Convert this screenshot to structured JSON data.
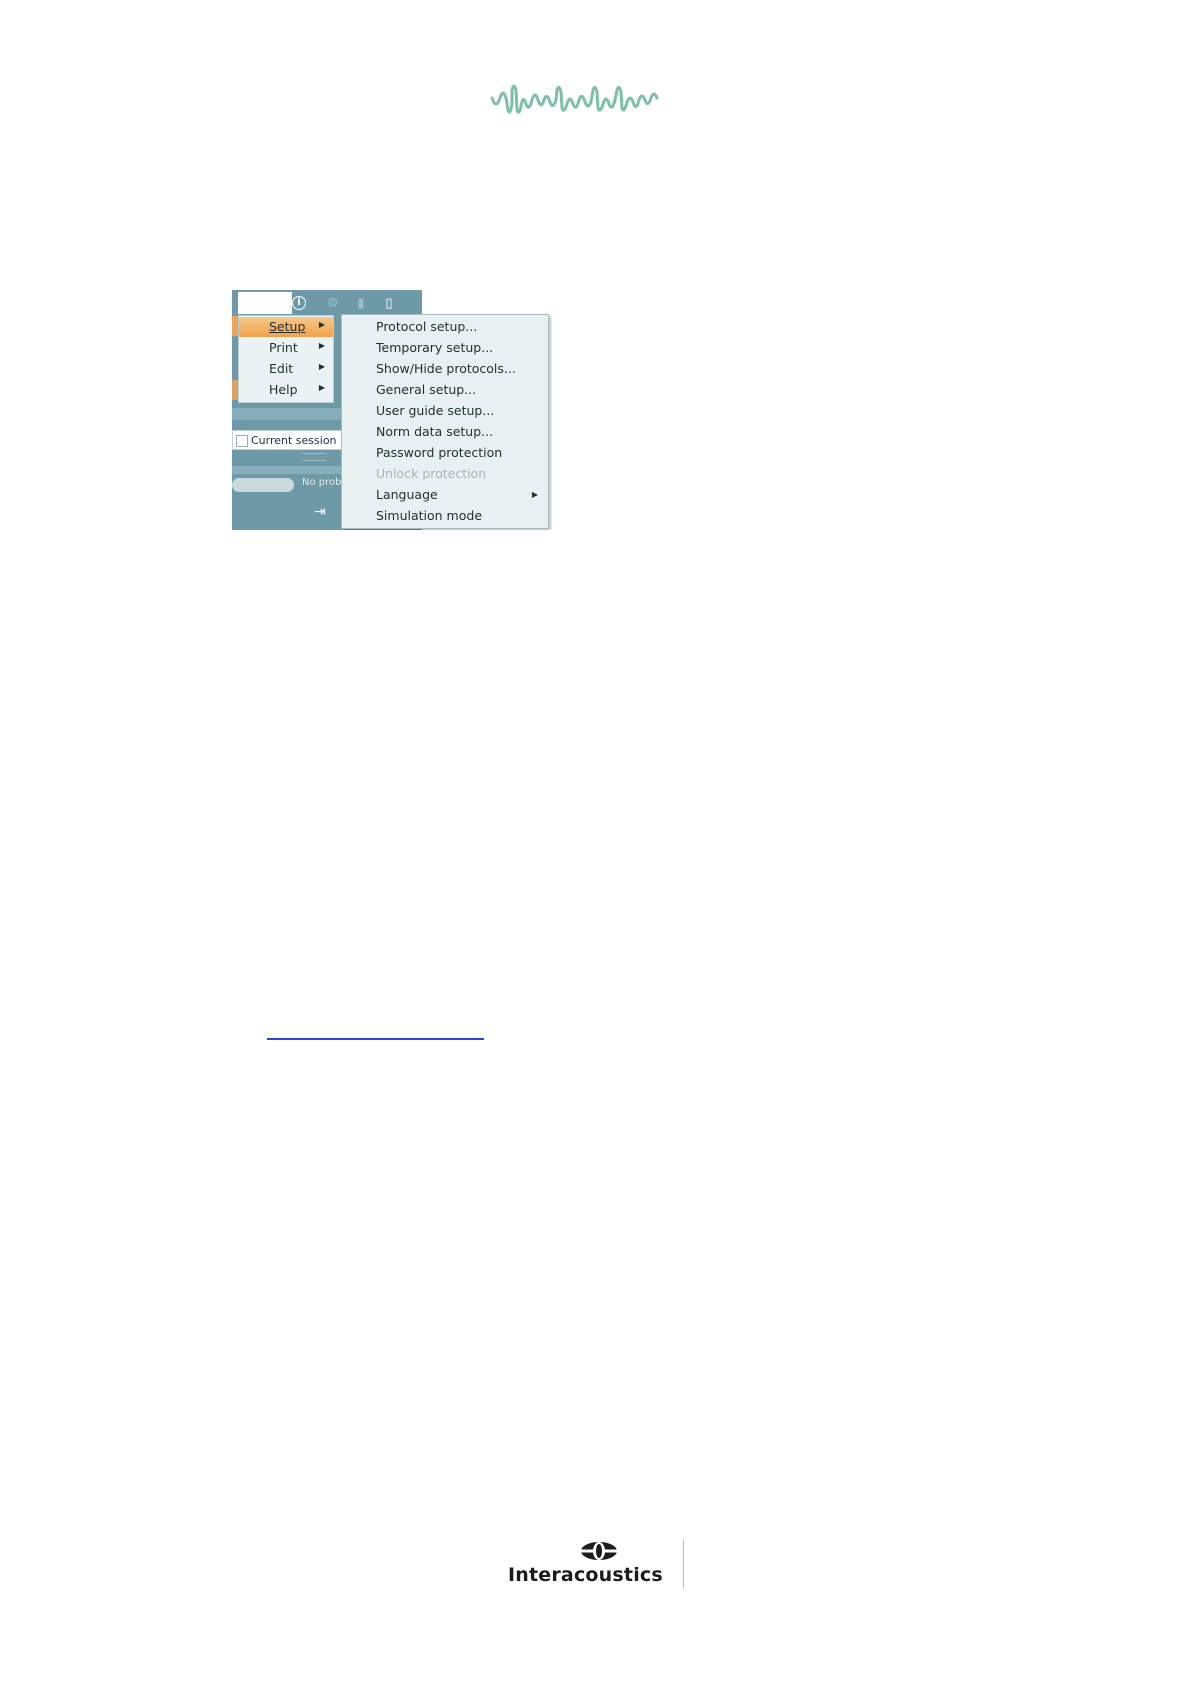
{
  "app_menu": {
    "items": [
      {
        "label": "Setup",
        "active": true
      },
      {
        "label": "Print",
        "active": false
      },
      {
        "label": "Edit",
        "active": false
      },
      {
        "label": "Help",
        "active": false
      }
    ]
  },
  "setup_submenu": {
    "items": [
      {
        "label": "Protocol setup...",
        "enabled": true
      },
      {
        "label": "Temporary setup...",
        "enabled": true
      },
      {
        "label": "Show/Hide protocols...",
        "enabled": true
      },
      {
        "label": "General setup...",
        "enabled": true
      },
      {
        "label": "User guide setup...",
        "enabled": true
      },
      {
        "label": "Norm data setup...",
        "enabled": true
      },
      {
        "label": "Password protection",
        "enabled": true
      },
      {
        "label": "Unlock protection",
        "enabled": false
      },
      {
        "label": "Language",
        "enabled": true,
        "has_submenu": true
      },
      {
        "label": "Simulation mode",
        "enabled": true
      }
    ]
  },
  "session": {
    "label": "Current session"
  },
  "probe_status": {
    "text": "No prob"
  },
  "brand": {
    "name": "Interacoustics"
  },
  "colors": {
    "wave": "#7cc0a6",
    "menu_highlight": "#f0a14a",
    "app_teal": "#6e9aa8",
    "link": "#2b46d8"
  }
}
